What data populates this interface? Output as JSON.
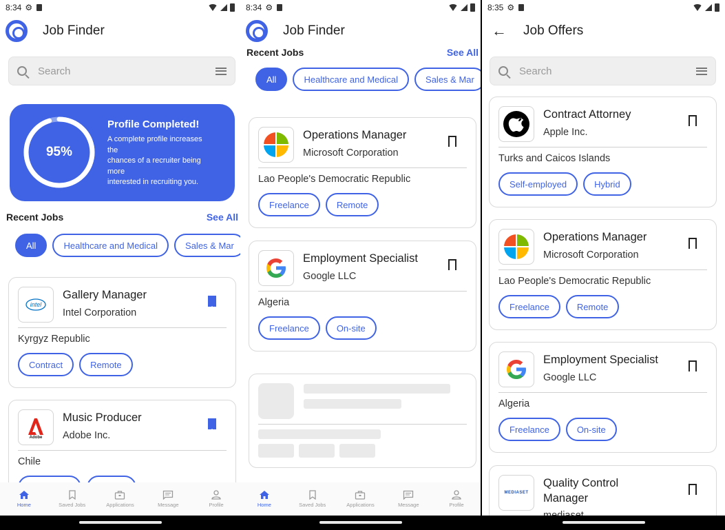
{
  "colors": {
    "accent": "#3f63e4"
  },
  "screens": [
    {
      "time": "8:34",
      "title": "Job Finder",
      "search_placeholder": "Search",
      "profile": {
        "percent": "95%",
        "progress": 0.95,
        "title": "Profile Completed!",
        "text_lines": [
          "A complete profile increases",
          "the",
          "chances of a recruiter being",
          "more",
          "interested in recruiting you."
        ]
      },
      "recent_jobs": "Recent Jobs",
      "see_all": "See All",
      "chips": [
        "All",
        "Healthcare and Medical",
        "Sales & Mar"
      ],
      "jobs": [
        {
          "title": "Gallery Manager",
          "company": "Intel Corporation",
          "location": "Kyrgyz Republic",
          "tags": [
            "Contract",
            "Remote"
          ],
          "logo": "intel-logo",
          "bookmarked": true
        },
        {
          "title": "Music Producer",
          "company": "Adobe Inc.",
          "location": "Chile",
          "tags": [
            "",
            ""
          ],
          "logo": "adobe-logo",
          "bookmarked": true
        }
      ],
      "nav": [
        "Home",
        "Saved Jobs",
        "Applications",
        "Message",
        "Profile"
      ]
    },
    {
      "time": "8:34",
      "title": "Job Finder",
      "recent_jobs": "Recent Jobs",
      "see_all": "See All",
      "chips": [
        "All",
        "Healthcare and Medical",
        "Sales & Mar"
      ],
      "jobs": [
        {
          "title": "Operations Manager",
          "company": "Microsoft Corporation",
          "location": "Lao People's Democratic Republic",
          "tags": [
            "Freelance",
            "Remote"
          ],
          "logo": "microsoft-logo",
          "bookmarked": false
        },
        {
          "title": "Employment Specialist",
          "company": "Google LLC",
          "location": "Algeria",
          "tags": [
            "Freelance",
            "On-site"
          ],
          "logo": "google-logo",
          "bookmarked": false
        }
      ],
      "nav": [
        "Home",
        "Saved Jobs",
        "Applications",
        "Message",
        "Profile"
      ]
    },
    {
      "time": "8:35",
      "title": "Job Offers",
      "search_placeholder": "Search",
      "jobs": [
        {
          "title": "Contract Attorney",
          "company": "Apple Inc.",
          "location": "Turks and Caicos Islands",
          "tags": [
            "Self-employed",
            "Hybrid"
          ],
          "logo": "apple-logo",
          "bookmarked": false
        },
        {
          "title": "Operations Manager",
          "company": "Microsoft Corporation",
          "location": "Lao People's Democratic Republic",
          "tags": [
            "Freelance",
            "Remote"
          ],
          "logo": "microsoft-logo",
          "bookmarked": false
        },
        {
          "title": "Employment Specialist",
          "company": "Google LLC",
          "location": "Algeria",
          "tags": [
            "Freelance",
            "On-site"
          ],
          "logo": "google-logo",
          "bookmarked": false
        },
        {
          "title_lines": [
            "Quality Control",
            "Manager"
          ],
          "company": "mediaset",
          "logo": "mediaset-logo",
          "logo_text": "MEDIASET",
          "bookmarked": false
        }
      ]
    }
  ]
}
